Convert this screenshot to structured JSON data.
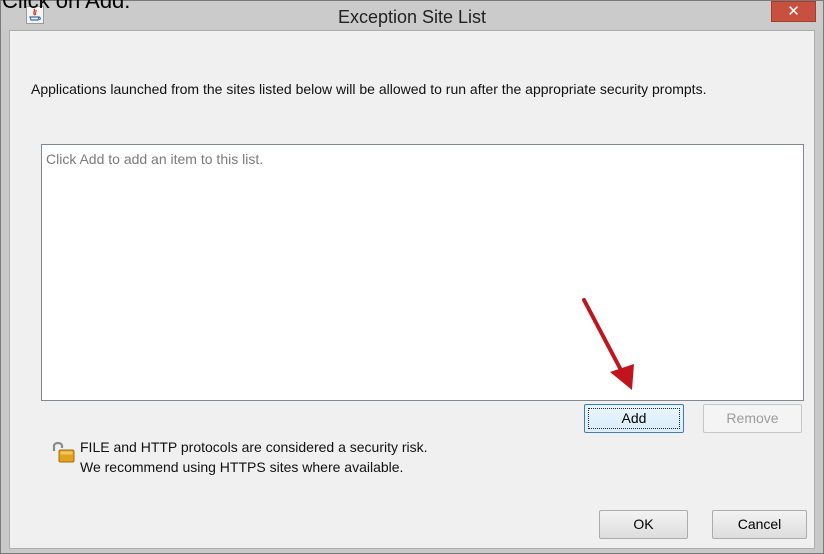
{
  "caption": "Click on Add.",
  "window": {
    "title": "Exception Site List",
    "close_glyph": "✕"
  },
  "description": "Applications launched from the sites listed below will be allowed to run after the appropriate security prompts.",
  "site_list": {
    "placeholder": "Click Add to add an item to this list."
  },
  "buttons": {
    "add": "Add",
    "remove": "Remove",
    "ok": "OK",
    "cancel": "Cancel"
  },
  "security_note": {
    "line1": "FILE and HTTP protocols are considered a security risk.",
    "line2": "We recommend using HTTPS sites where available."
  },
  "icons": {
    "app": "java-icon",
    "close": "close-icon",
    "lock": "unlocked-padlock-icon",
    "annotation": "red-arrow-icon"
  },
  "colors": {
    "close_button": "#c7503e",
    "arrow": "#c0151d",
    "dialog_background": "#f0f0f0",
    "titlebar": "#cbcbcb"
  }
}
